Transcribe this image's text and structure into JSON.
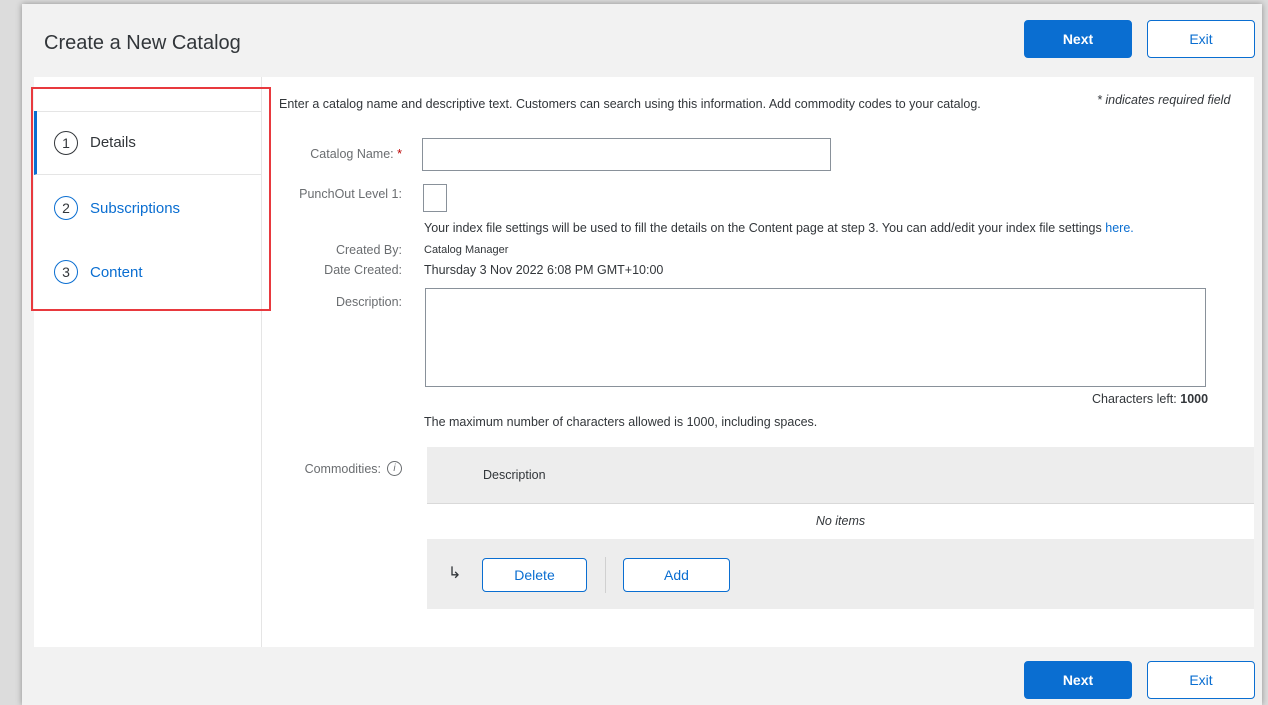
{
  "header": {
    "title": "Create a New Catalog",
    "next_label": "Next",
    "exit_label": "Exit"
  },
  "steps": [
    {
      "number": "1",
      "label": "Details",
      "active": true
    },
    {
      "number": "2",
      "label": "Subscriptions",
      "active": false
    },
    {
      "number": "3",
      "label": "Content",
      "active": false
    }
  ],
  "form": {
    "intro": "Enter a catalog name and descriptive text. Customers can search using this information. Add commodity codes to your catalog.",
    "required_note": "* indicates required field",
    "catalog_name_label": "Catalog Name:",
    "required_mark": "*",
    "catalog_name_value": "",
    "punchout_label": "PunchOut Level 1:",
    "index_note": "Your index file settings will be used to fill the details on the Content page at step 3. You can add/edit your index file settings",
    "index_link": "here.",
    "created_by_label": "Created By:",
    "created_by_value": "Catalog Manager",
    "date_created_label": "Date Created:",
    "date_created_value": "Thursday 3 Nov 2022 6:08 PM GMT+10:00",
    "description_label": "Description:",
    "description_value": "",
    "chars_left_label": "Characters left:",
    "chars_left_value": "1000",
    "max_chars_note": "The maximum number of characters allowed is 1000, including spaces.",
    "commodities_label": "Commodities:",
    "info_icon_glyph": "i"
  },
  "commodities_table": {
    "column_description": "Description",
    "empty_text": "No items",
    "delete_label": "Delete",
    "add_label": "Add",
    "arrow_glyph": "↳"
  },
  "footer": {
    "next_label": "Next",
    "exit_label": "Exit"
  },
  "colors": {
    "accent": "#0a6ed1",
    "highlight_border": "#e8393e"
  }
}
